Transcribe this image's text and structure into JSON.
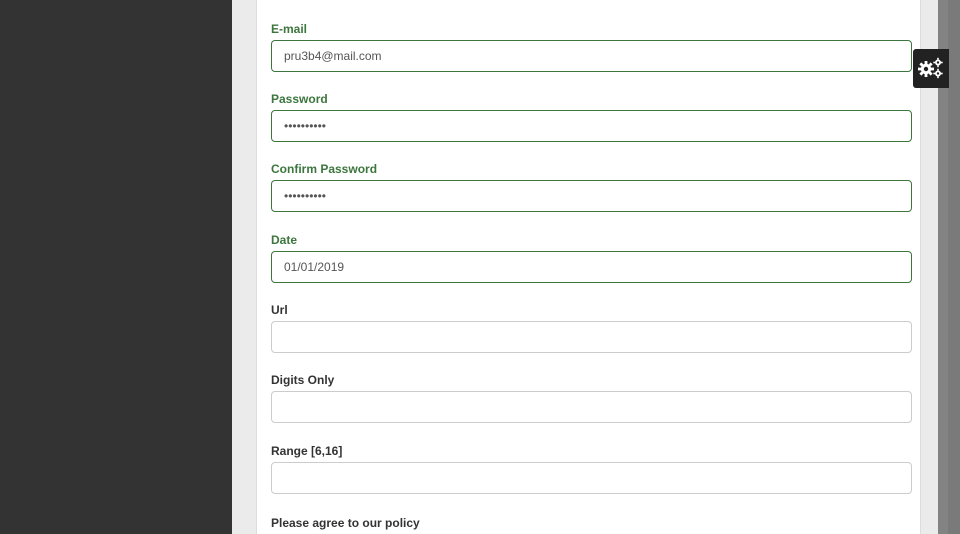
{
  "form": {
    "email": {
      "label": "E-mail",
      "value": "pru3b4@mail.com",
      "state": "valid"
    },
    "password": {
      "label": "Password",
      "value": "••••••••••",
      "state": "valid"
    },
    "confirm_password": {
      "label": "Confirm Password",
      "value": "••••••••••",
      "state": "valid"
    },
    "date": {
      "label": "Date",
      "value": "01/01/2019",
      "state": "valid"
    },
    "url": {
      "label": "Url",
      "value": ""
    },
    "digits_only": {
      "label": "Digits Only",
      "value": ""
    },
    "range": {
      "label": "Range [6,16]",
      "value": ""
    },
    "policy": {
      "label": "Please agree to our policy"
    }
  },
  "settings_button": {
    "icon": "gears-icon"
  },
  "colors": {
    "valid": "#3c763d",
    "default_border": "#cccccc",
    "sidebar": "#333333",
    "page_background": "#ebebeb"
  }
}
